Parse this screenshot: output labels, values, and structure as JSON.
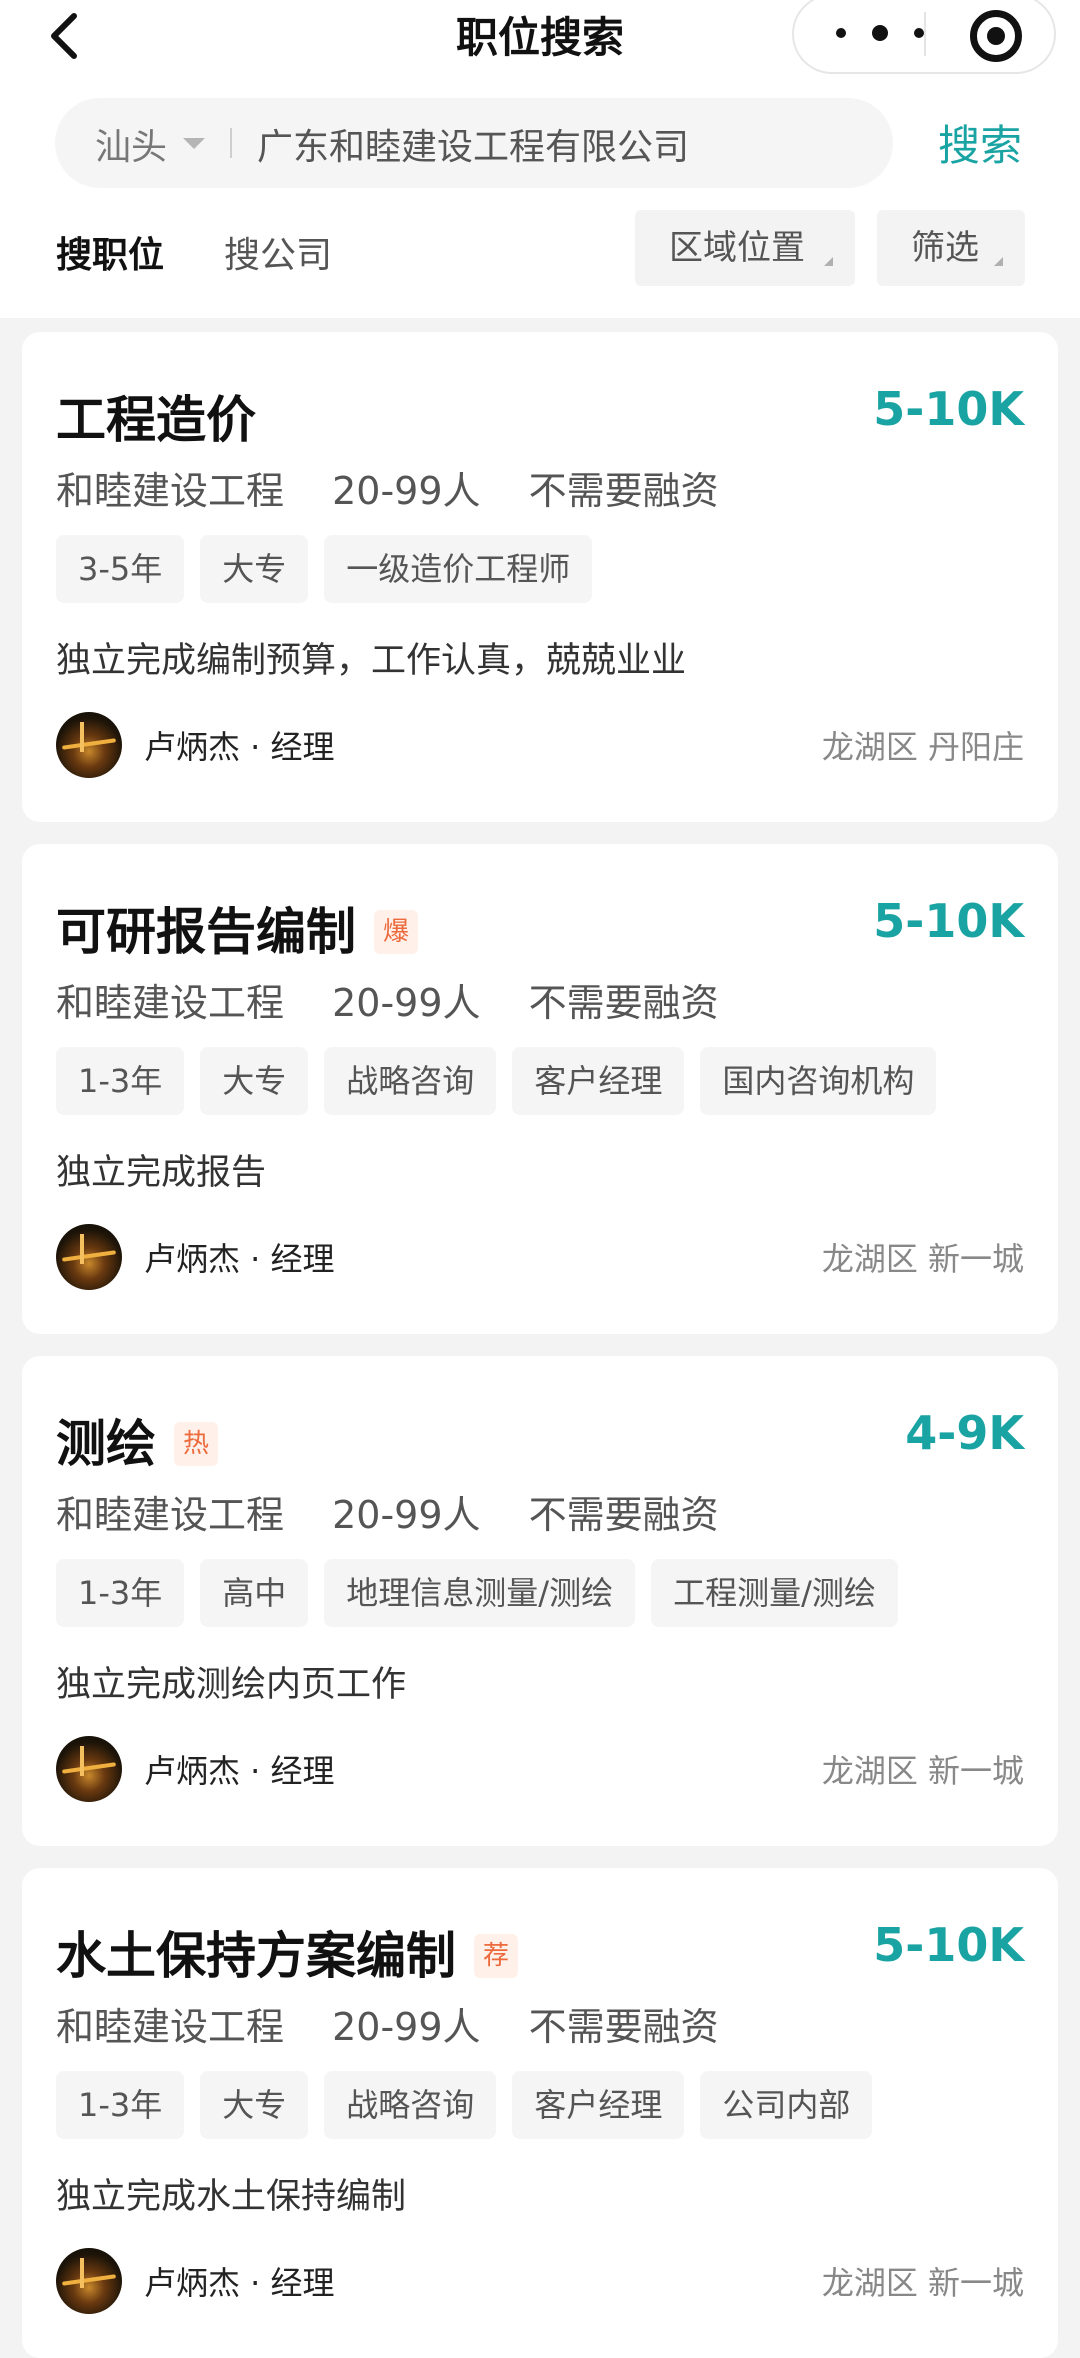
{
  "nav": {
    "title": "职位搜索"
  },
  "search": {
    "city": "汕头",
    "query": "广东和睦建设工程有限公司",
    "button": "搜索"
  },
  "tabs": {
    "jobs": "搜职位",
    "companies": "搜公司",
    "region_filter": "区域位置",
    "filter": "筛选"
  },
  "jobs": [
    {
      "title": "工程造价",
      "badge": "",
      "salary": "5-10K",
      "company": "和睦建设工程",
      "size": "20-99人",
      "funding": "不需要融资",
      "tags": [
        "3-5年",
        "大专",
        "一级造价工程师"
      ],
      "desc": "独立完成编制预算，工作认真，兢兢业业",
      "recruiter": "卢炳杰 · 经理",
      "location": "龙湖区 丹阳庄"
    },
    {
      "title": "可研报告编制",
      "badge": "爆",
      "salary": "5-10K",
      "company": "和睦建设工程",
      "size": "20-99人",
      "funding": "不需要融资",
      "tags": [
        "1-3年",
        "大专",
        "战略咨询",
        "客户经理",
        "国内咨询机构"
      ],
      "desc": "独立完成报告",
      "recruiter": "卢炳杰 · 经理",
      "location": "龙湖区 新一城"
    },
    {
      "title": "测绘",
      "badge": "热",
      "salary": "4-9K",
      "company": "和睦建设工程",
      "size": "20-99人",
      "funding": "不需要融资",
      "tags": [
        "1-3年",
        "高中",
        "地理信息测量/测绘",
        "工程测量/测绘"
      ],
      "desc": "独立完成测绘内页工作",
      "recruiter": "卢炳杰 · 经理",
      "location": "龙湖区 新一城"
    },
    {
      "title": "水土保持方案编制",
      "badge": "荐",
      "salary": "5-10K",
      "company": "和睦建设工程",
      "size": "20-99人",
      "funding": "不需要融资",
      "tags": [
        "1-3年",
        "大专",
        "战略咨询",
        "客户经理",
        "公司内部"
      ],
      "desc": "独立完成水土保持编制",
      "recruiter": "卢炳杰 · 经理",
      "location": "龙湖区 新一城"
    }
  ]
}
